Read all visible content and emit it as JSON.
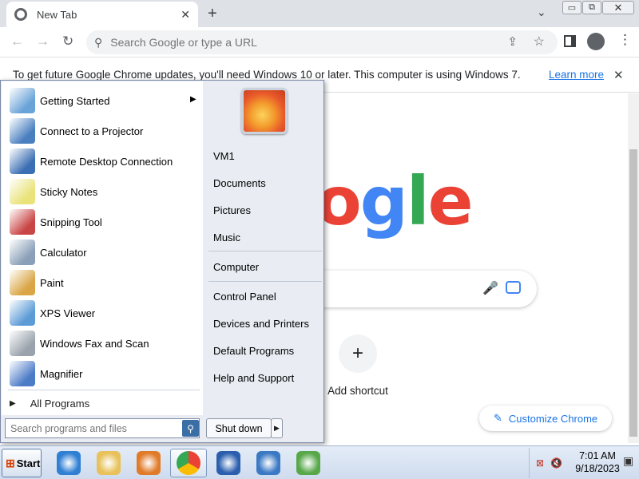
{
  "browser": {
    "tab_title": "New Tab",
    "tab_close": "✕",
    "new_tab": "+",
    "tab_menu": "⌄",
    "window_controls": {
      "minimize": "▭",
      "maximize": "⧉",
      "close": "✕"
    },
    "omnibox_placeholder": "Search Google or type a URL",
    "infobar_text": "To get future Google Chrome updates, you'll need Windows 10 or later. This computer is using Windows 7.",
    "infobar_link": "Learn more",
    "infobar_close": "✕"
  },
  "ntp": {
    "logo_letters": [
      {
        "ch": "o",
        "color": "#ea4335"
      },
      {
        "ch": "g",
        "color": "#4285f4"
      },
      {
        "ch": "l",
        "color": "#34a853"
      },
      {
        "ch": "e",
        "color": "#ea4335"
      }
    ],
    "add_shortcut_label": "Add shortcut",
    "add_shortcut_icon": "+",
    "customize_label": "Customize Chrome",
    "customize_icon": "✎"
  },
  "startmenu": {
    "programs": [
      {
        "label": "Getting Started",
        "icon": "getting-started-icon",
        "color": "#6aa3d8",
        "has_submenu": true
      },
      {
        "label": "Connect to a Projector",
        "icon": "projector-icon",
        "color": "#4a7fbf",
        "has_submenu": false
      },
      {
        "label": "Remote Desktop Connection",
        "icon": "remote-desktop-icon",
        "color": "#3b6fb3",
        "has_submenu": false
      },
      {
        "label": "Sticky Notes",
        "icon": "sticky-notes-icon",
        "color": "#e9e37a",
        "has_submenu": false
      },
      {
        "label": "Snipping Tool",
        "icon": "scissors-icon",
        "color": "#c94646",
        "has_submenu": false
      },
      {
        "label": "Calculator",
        "icon": "calculator-icon",
        "color": "#8aa0b8",
        "has_submenu": false
      },
      {
        "label": "Paint",
        "icon": "paint-icon",
        "color": "#d9a545",
        "has_submenu": false
      },
      {
        "label": "XPS Viewer",
        "icon": "xps-viewer-icon",
        "color": "#5c9bd6",
        "has_submenu": false
      },
      {
        "label": "Windows Fax and Scan",
        "icon": "fax-icon",
        "color": "#9aa3ad",
        "has_submenu": false
      },
      {
        "label": "Magnifier",
        "icon": "magnifier-icon",
        "color": "#4d7cc7",
        "has_submenu": false
      }
    ],
    "submenu_arrow": "▶",
    "all_programs": "All Programs",
    "all_programs_arrow": "▶",
    "search_placeholder": "Search programs and files",
    "search_icon": "⚲",
    "right_links": [
      {
        "label": "VM1",
        "name": "user-folder-link"
      },
      {
        "label": "Documents",
        "name": "documents-link"
      },
      {
        "label": "Pictures",
        "name": "pictures-link"
      },
      {
        "label": "Music",
        "name": "music-link"
      },
      {
        "label": "Computer",
        "name": "computer-link"
      },
      {
        "label": "Control Panel",
        "name": "control-panel-link"
      },
      {
        "label": "Devices and Printers",
        "name": "devices-printers-link"
      },
      {
        "label": "Default Programs",
        "name": "default-programs-link"
      },
      {
        "label": "Help and Support",
        "name": "help-support-link"
      }
    ],
    "shutdown_label": "Shut down",
    "shutdown_arrow": "▶"
  },
  "taskbar": {
    "start_label": "Start",
    "start_logo": "⊞",
    "apps": [
      {
        "name": "internet-explorer-icon",
        "color": "#2f7fd3"
      },
      {
        "name": "windows-explorer-icon",
        "color": "#e8c15a"
      },
      {
        "name": "media-player-icon",
        "color": "#e07b2a"
      },
      {
        "name": "chrome-icon",
        "color": "#34a853"
      },
      {
        "name": "help-icon",
        "color": "#2b5fae"
      },
      {
        "name": "action-center-icon",
        "color": "#3b79c4"
      },
      {
        "name": "windows-logo-icon",
        "color": "#58a84a"
      }
    ],
    "tray_icons": [
      {
        "name": "network-icon",
        "glyph": "⊠",
        "color": "#c0392b"
      },
      {
        "name": "volume-icon",
        "glyph": "🔇",
        "color": "#444"
      }
    ],
    "time": "7:01 AM",
    "date": "9/18/2023",
    "show_desktop": "▣"
  }
}
